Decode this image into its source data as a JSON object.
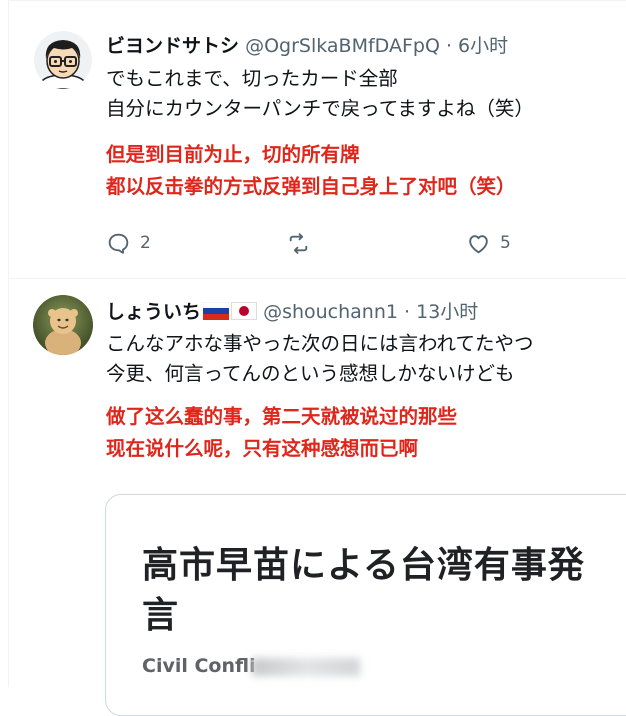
{
  "tweets": [
    {
      "name": "ビヨンドサトシ",
      "handle": "@OgrSlkaBMfDAFpQ",
      "dot": "·",
      "time": "6小时",
      "text_lines": [
        "でもこれまで、切ったカード全部",
        "自分にカウンターパンチで戻ってますよね（笑）"
      ],
      "translation_lines": [
        "但是到目前为止，切的所有牌",
        "都以反击拳的方式反弹到自己身上了对吧（笑）"
      ],
      "replies": "2",
      "likes": "5"
    },
    {
      "name": "しょういち",
      "handle": "@shouchann1",
      "dot": "·",
      "time": "13小时",
      "text_lines": [
        "こんなアホな事やった次の日には言われてたやつ",
        "今更、何言ってんのという感想しかないけども"
      ],
      "translation_lines": [
        "做了这么蠢的事，第二天就被说过的那些",
        "现在说什么呢，只有这种感想而已啊"
      ],
      "card": {
        "title_lines": [
          "高市早苗による台湾有事発",
          "言"
        ],
        "subtitle": "Civil Confli"
      }
    }
  ],
  "colors": {
    "name": "#0f1419",
    "meta": "#536471",
    "translation": "#e0261b",
    "border": "#eff3f4"
  }
}
